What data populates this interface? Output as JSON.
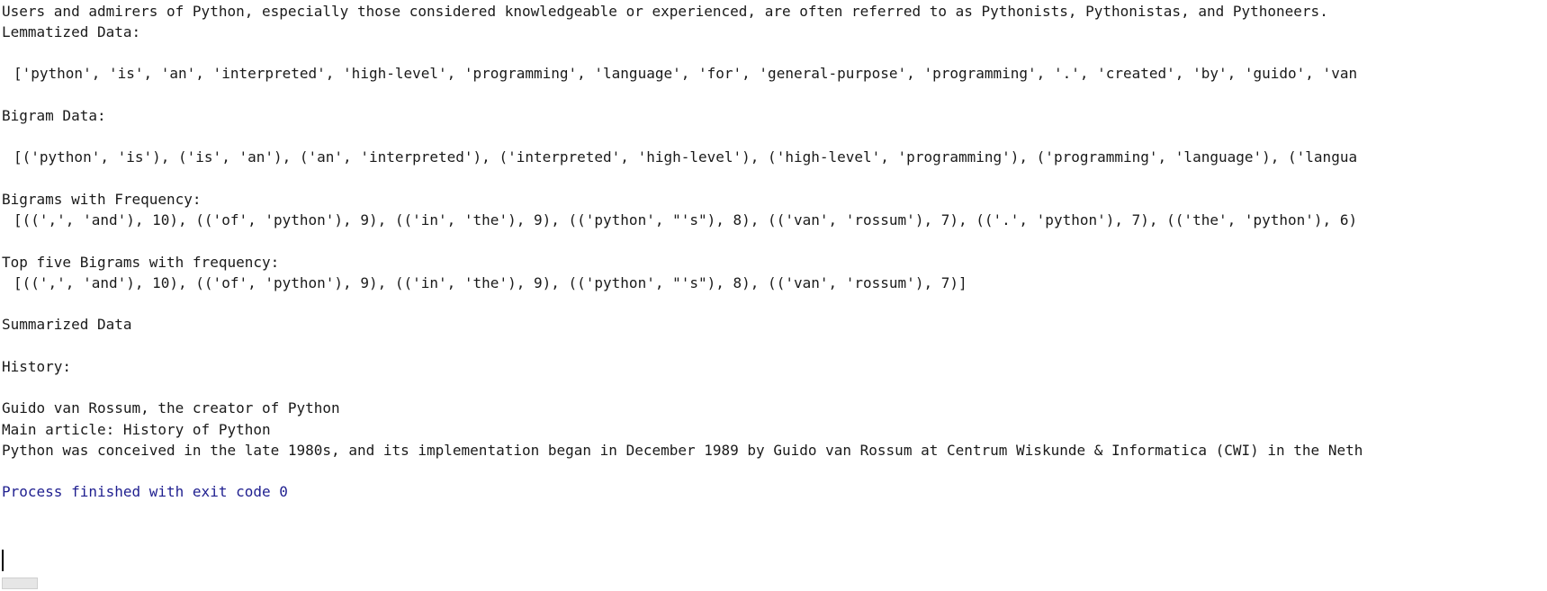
{
  "console": {
    "lines": {
      "intro": "Users and admirers of Python, especially those considered knowledgeable or experienced, are often referred to as Pythonists, Pythonistas, and Pythoneers.",
      "lemmatized_label": "Lemmatized Data:",
      "lemmatized_value": "['python', 'is', 'an', 'interpreted', 'high-level', 'programming', 'language', 'for', 'general-purpose', 'programming', '.', 'created', 'by', 'guido', 'van",
      "bigram_label": "Bigram Data:",
      "bigram_value": "[('python', 'is'), ('is', 'an'), ('an', 'interpreted'), ('interpreted', 'high-level'), ('high-level', 'programming'), ('programming', 'language'), ('langua",
      "bigram_freq_label": "Bigrams with Frequency:",
      "bigram_freq_value": "[((',', 'and'), 10), (('of', 'python'), 9), (('in', 'the'), 9), (('python', \"'s\"), 8), (('van', 'rossum'), 7), (('.', 'python'), 7), (('the', 'python'), 6)",
      "top_five_label": "Top five Bigrams with frequency:",
      "top_five_value": "[((',', 'and'), 10), (('of', 'python'), 9), (('in', 'the'), 9), (('python', \"'s\"), 8), (('van', 'rossum'), 7)]",
      "summarized_label": "Summarized Data",
      "history_label": "History:",
      "guido_caption": "Guido van Rossum, the creator of Python",
      "main_article": "Main article: History of Python",
      "history_text": "Python was conceived in the late 1980s, and its implementation began in December 1989 by Guido van Rossum at Centrum Wiskunde & Informatica (CWI) in the Neth",
      "exit_message": "Process finished with exit code 0"
    },
    "colors": {
      "text": "#1a1a1a",
      "exit_message": "#1f1f8f",
      "background": "#ffffff"
    }
  }
}
